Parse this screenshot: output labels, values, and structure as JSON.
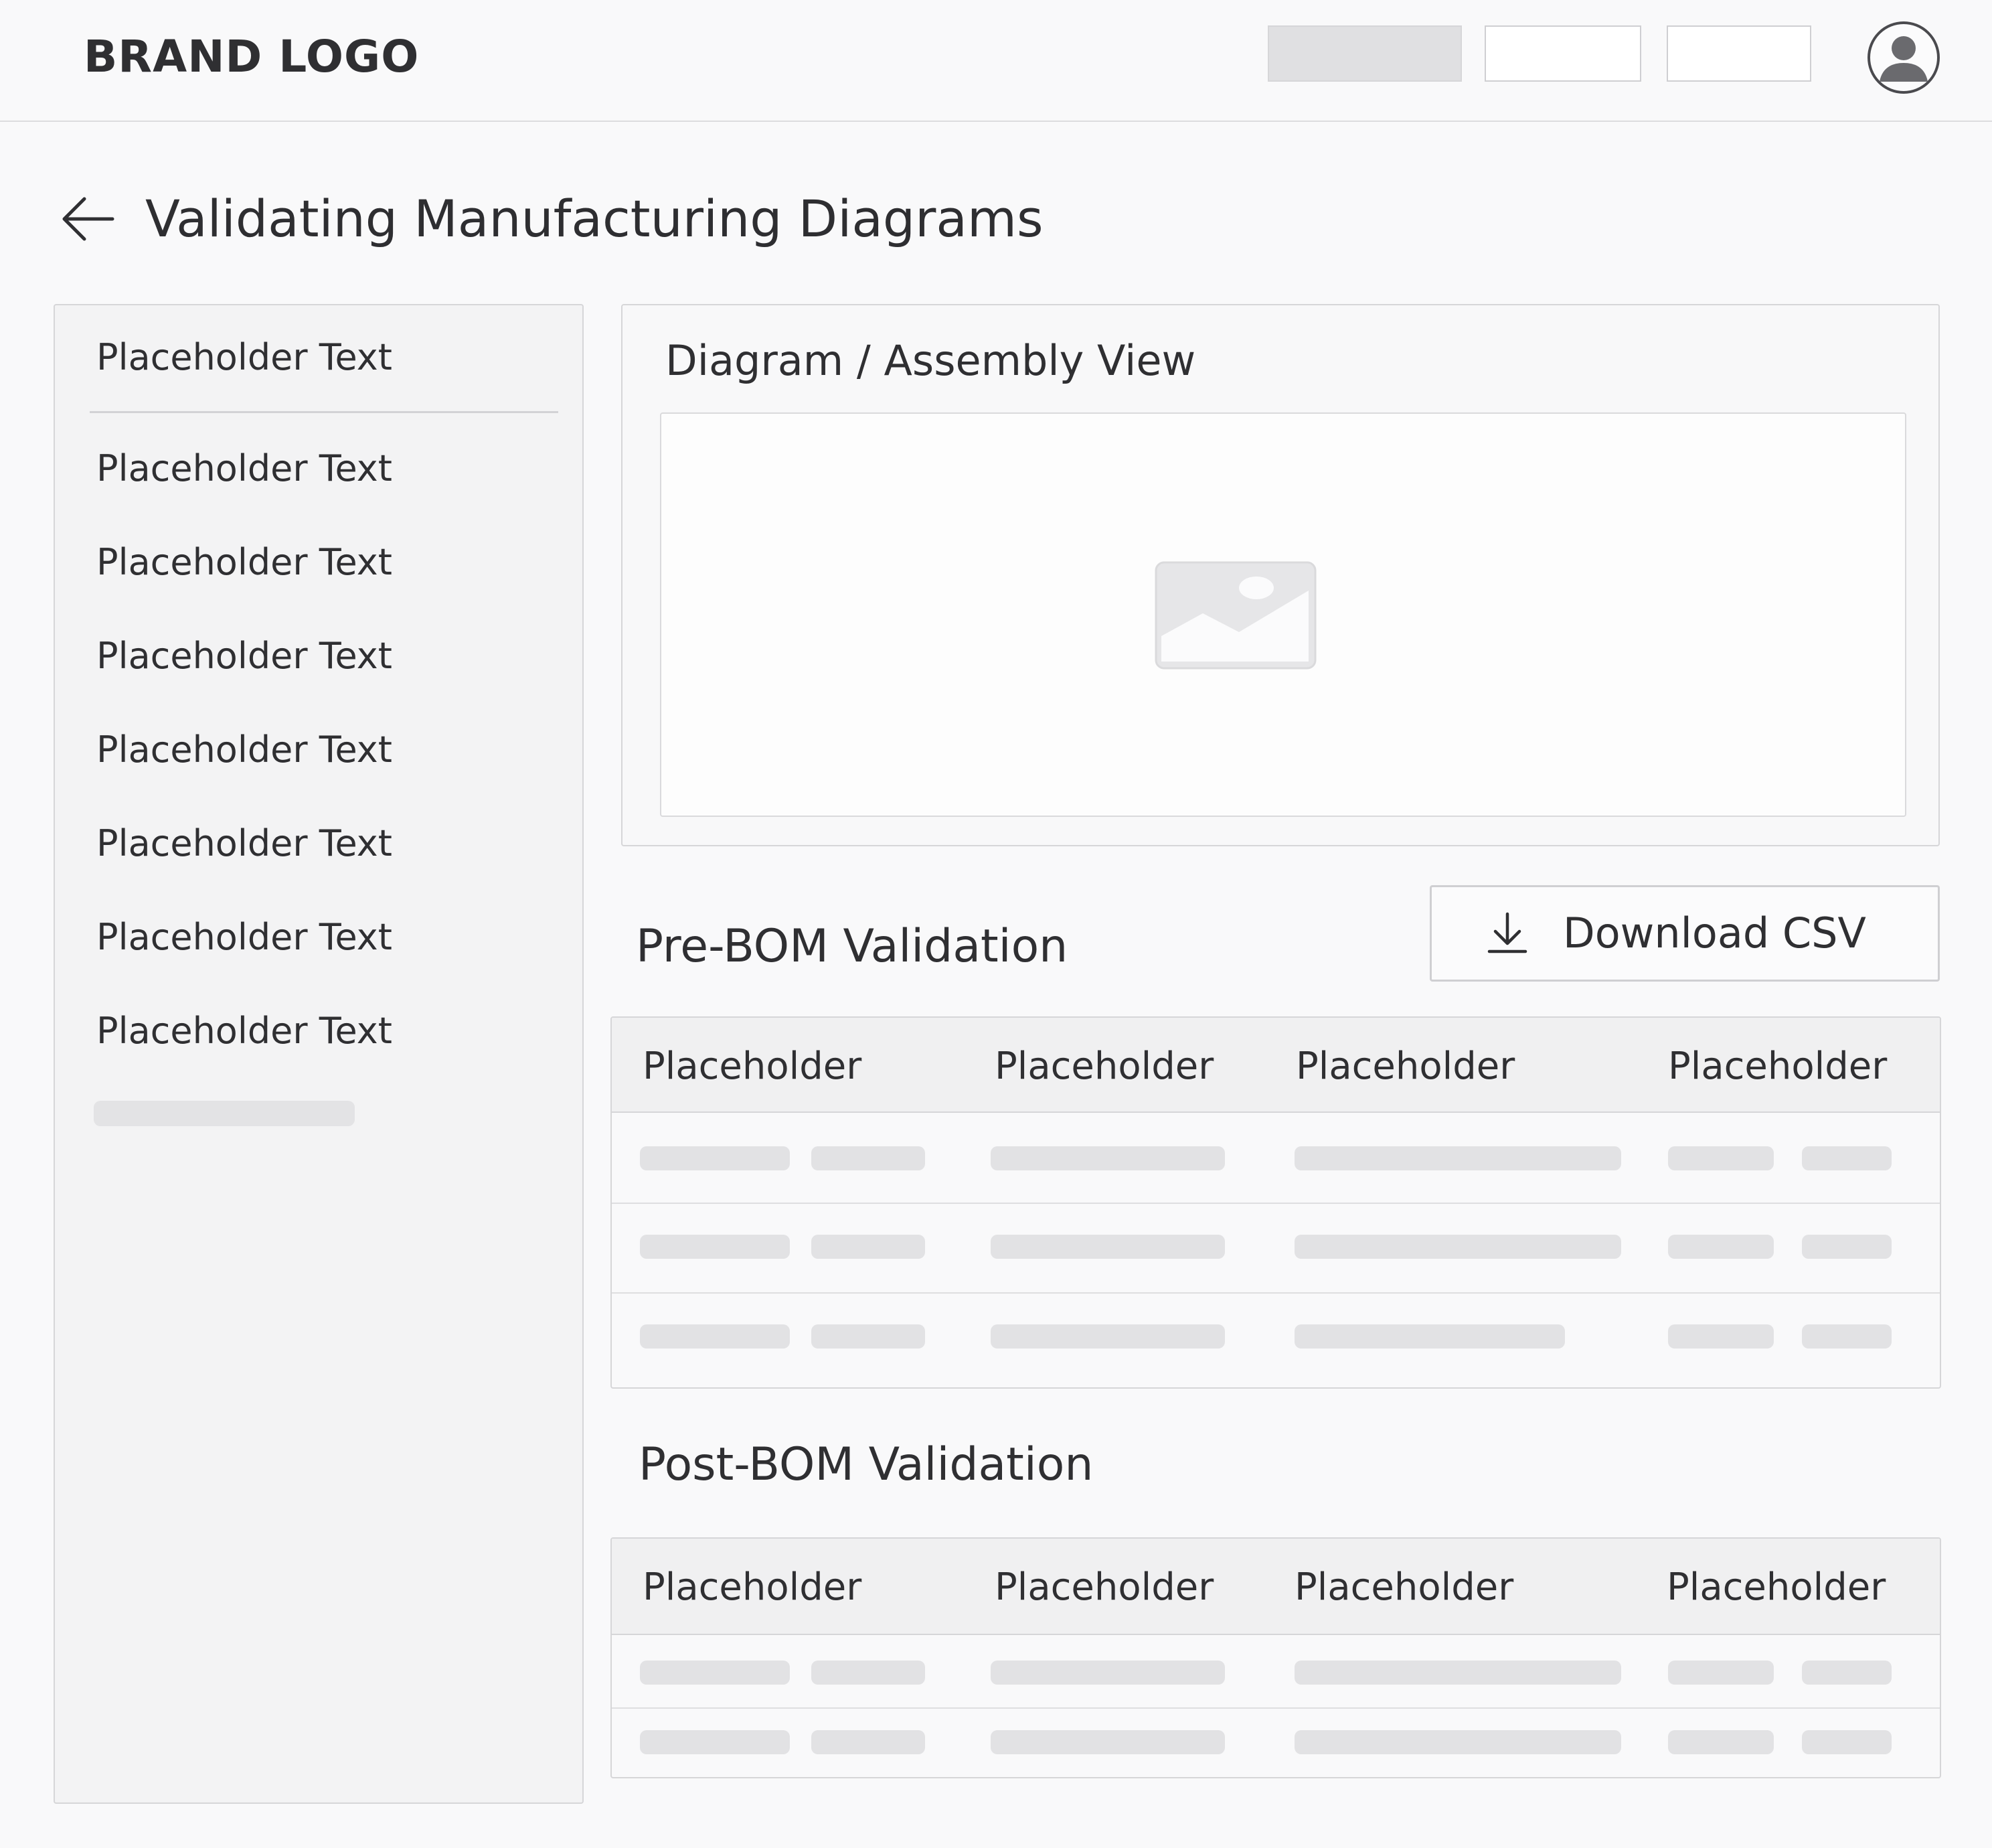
{
  "header": {
    "brand": "BRAND LOGO",
    "avatar_icon": "user-avatar-icon"
  },
  "page": {
    "title": "Validating Manufacturing Diagrams",
    "back_icon": "arrow-left-icon"
  },
  "sidebar": {
    "items": [
      {
        "label": "Placeholder Text"
      },
      {
        "label": "Placeholder Text"
      },
      {
        "label": "Placeholder Text"
      },
      {
        "label": "Placeholder Text"
      },
      {
        "label": "Placeholder Text"
      },
      {
        "label": "Placeholder Text"
      },
      {
        "label": "Placeholder Text"
      },
      {
        "label": "Placeholder Text"
      }
    ]
  },
  "diagram": {
    "title": "Diagram / Assembly View",
    "icon": "image-placeholder-icon"
  },
  "pre_bom": {
    "title": "Pre-BOM Validation",
    "download_label": "Download CSV",
    "download_icon": "download-icon",
    "columns": [
      "Placeholder",
      "Placeholder",
      "Placeholder",
      "Placeholder"
    ],
    "row_count": 3
  },
  "post_bom": {
    "title": "Post-BOM Validation",
    "columns": [
      "Placeholder",
      "Placeholder",
      "Placeholder",
      "Placeholder"
    ],
    "row_count": 2
  },
  "colors": {
    "background": "#f9f9fa",
    "panel_border": "#d6d6d8",
    "skeleton": "#e2e2e4",
    "text": "#2f2f32"
  }
}
